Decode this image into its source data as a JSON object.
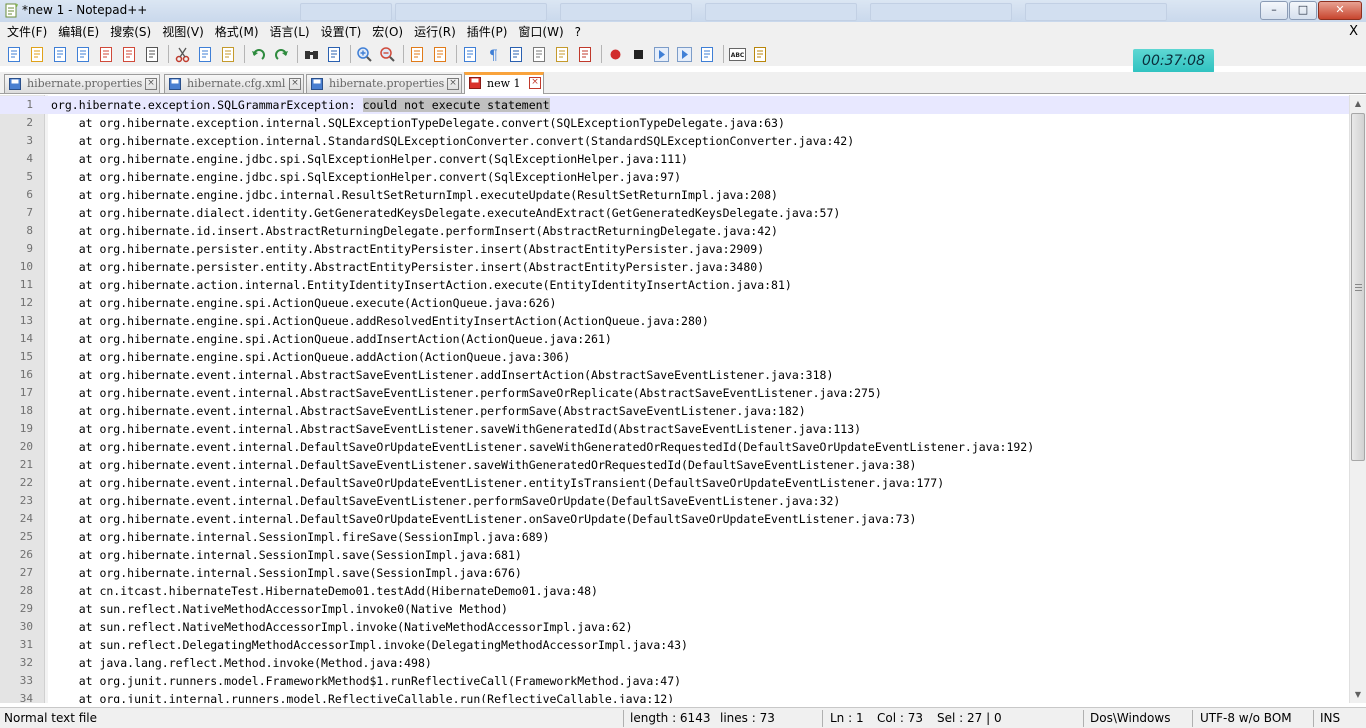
{
  "window": {
    "title": "*new  1 - Notepad++",
    "buttons": {
      "minimize": "–",
      "maximize": "□",
      "close": "✕"
    }
  },
  "menu": {
    "items": [
      "文件(F)",
      "编辑(E)",
      "搜索(S)",
      "视图(V)",
      "格式(M)",
      "语言(L)",
      "设置(T)",
      "宏(O)",
      "运行(R)",
      "插件(P)",
      "窗口(W)",
      "?"
    ],
    "close_glyph": "X"
  },
  "toolbar": {
    "icons": [
      "new-file-icon",
      "open-file-icon",
      "save-icon",
      "save-all-icon",
      "close-icon",
      "close-all-icon",
      "print-icon",
      "cut-icon",
      "copy-icon",
      "paste-icon",
      "undo-icon",
      "redo-icon",
      "find-icon",
      "replace-icon",
      "zoom-in-icon",
      "zoom-out-icon",
      "sync-vertical-icon",
      "sync-horizontal-icon",
      "word-wrap-icon",
      "show-all-chars-icon",
      "indent-guide-icon",
      "udl-icon",
      "doc-map-icon",
      "function-list-icon",
      "record-macro-icon",
      "stop-record-icon",
      "play-macro-icon",
      "run-multiple-macro-icon",
      "save-macro-icon",
      "spell-check-icon",
      "plugin-icon"
    ]
  },
  "timer": {
    "value": "00:37:08"
  },
  "tabs": [
    {
      "label": "hibernate.properties",
      "active": false
    },
    {
      "label": "hibernate.cfg.xml",
      "active": false
    },
    {
      "label": "hibernate.properties",
      "active": false
    },
    {
      "label": "new  1",
      "active": true
    }
  ],
  "editor": {
    "lines": [
      "org.hibernate.exception.SQLGrammarException: could not execute statement",
      "    at org.hibernate.exception.internal.SQLExceptionTypeDelegate.convert(SQLExceptionTypeDelegate.java:63)",
      "    at org.hibernate.exception.internal.StandardSQLExceptionConverter.convert(StandardSQLExceptionConverter.java:42)",
      "    at org.hibernate.engine.jdbc.spi.SqlExceptionHelper.convert(SqlExceptionHelper.java:111)",
      "    at org.hibernate.engine.jdbc.spi.SqlExceptionHelper.convert(SqlExceptionHelper.java:97)",
      "    at org.hibernate.engine.jdbc.internal.ResultSetReturnImpl.executeUpdate(ResultSetReturnImpl.java:208)",
      "    at org.hibernate.dialect.identity.GetGeneratedKeysDelegate.executeAndExtract(GetGeneratedKeysDelegate.java:57)",
      "    at org.hibernate.id.insert.AbstractReturningDelegate.performInsert(AbstractReturningDelegate.java:42)",
      "    at org.hibernate.persister.entity.AbstractEntityPersister.insert(AbstractEntityPersister.java:2909)",
      "    at org.hibernate.persister.entity.AbstractEntityPersister.insert(AbstractEntityPersister.java:3480)",
      "    at org.hibernate.action.internal.EntityIdentityInsertAction.execute(EntityIdentityInsertAction.java:81)",
      "    at org.hibernate.engine.spi.ActionQueue.execute(ActionQueue.java:626)",
      "    at org.hibernate.engine.spi.ActionQueue.addResolvedEntityInsertAction(ActionQueue.java:280)",
      "    at org.hibernate.engine.spi.ActionQueue.addInsertAction(ActionQueue.java:261)",
      "    at org.hibernate.engine.spi.ActionQueue.addAction(ActionQueue.java:306)",
      "    at org.hibernate.event.internal.AbstractSaveEventListener.addInsertAction(AbstractSaveEventListener.java:318)",
      "    at org.hibernate.event.internal.AbstractSaveEventListener.performSaveOrReplicate(AbstractSaveEventListener.java:275)",
      "    at org.hibernate.event.internal.AbstractSaveEventListener.performSave(AbstractSaveEventListener.java:182)",
      "    at org.hibernate.event.internal.AbstractSaveEventListener.saveWithGeneratedId(AbstractSaveEventListener.java:113)",
      "    at org.hibernate.event.internal.DefaultSaveOrUpdateEventListener.saveWithGeneratedOrRequestedId(DefaultSaveOrUpdateEventListener.java:192)",
      "    at org.hibernate.event.internal.DefaultSaveEventListener.saveWithGeneratedOrRequestedId(DefaultSaveEventListener.java:38)",
      "    at org.hibernate.event.internal.DefaultSaveOrUpdateEventListener.entityIsTransient(DefaultSaveOrUpdateEventListener.java:177)",
      "    at org.hibernate.event.internal.DefaultSaveEventListener.performSaveOrUpdate(DefaultSaveEventListener.java:32)",
      "    at org.hibernate.event.internal.DefaultSaveOrUpdateEventListener.onSaveOrUpdate(DefaultSaveOrUpdateEventListener.java:73)",
      "    at org.hibernate.internal.SessionImpl.fireSave(SessionImpl.java:689)",
      "    at org.hibernate.internal.SessionImpl.save(SessionImpl.java:681)",
      "    at org.hibernate.internal.SessionImpl.save(SessionImpl.java:676)",
      "    at cn.itcast.hibernateTest.HibernateDemo01.testAdd(HibernateDemo01.java:48)",
      "    at sun.reflect.NativeMethodAccessorImpl.invoke0(Native Method)",
      "    at sun.reflect.NativeMethodAccessorImpl.invoke(NativeMethodAccessorImpl.java:62)",
      "    at sun.reflect.DelegatingMethodAccessorImpl.invoke(DelegatingMethodAccessorImpl.java:43)",
      "    at java.lang.reflect.Method.invoke(Method.java:498)",
      "    at org.junit.runners.model.FrameworkMethod$1.runReflectiveCall(FrameworkMethod.java:47)",
      "    at org.junit.internal.runners.model.ReflectiveCallable.run(ReflectiveCallable.java:12)"
    ],
    "selected_text": "could not execute statement",
    "current_line": 1
  },
  "statusbar": {
    "file_type": "Normal text file",
    "length": "length : 6143",
    "lines": "lines : 73",
    "ln": "Ln : 1",
    "col": "Col : 73",
    "sel": "Sel : 27 | 0",
    "eol": "Dos\\Windows",
    "encoding": "UTF-8 w/o BOM",
    "mode": "INS"
  },
  "colors": {
    "accent_tab": "#f9a33c",
    "current_line": "#e8e8ff",
    "selection": "#c0c0c0",
    "timer_bg": "#2ec2c0"
  }
}
